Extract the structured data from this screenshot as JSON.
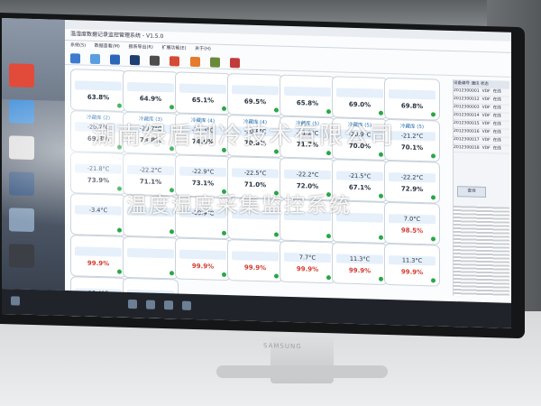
{
  "app": {
    "title": "温湿度数据记录监控管理系统 - V1.5.0",
    "menu": [
      "系统(S)",
      "数据查看(M)",
      "报表导出(R)",
      "扩展功能(E)",
      "关于(H)"
    ]
  },
  "cards": [
    {
      "name": "",
      "temp": "",
      "hum": "63.8%",
      "warn": false
    },
    {
      "name": "",
      "temp": "",
      "hum": "64.9%",
      "warn": false
    },
    {
      "name": "",
      "temp": "",
      "hum": "65.1%",
      "warn": false
    },
    {
      "name": "",
      "temp": "",
      "hum": "69.5%",
      "warn": false
    },
    {
      "name": "",
      "temp": "",
      "hum": "65.8%",
      "warn": false
    },
    {
      "name": "",
      "temp": "",
      "hum": "69.0%",
      "warn": false
    },
    {
      "name": "",
      "temp": "",
      "hum": "69.8%",
      "warn": false
    },
    {
      "name": "冷藏库 (2)",
      "temp": "-20.7°C",
      "hum": "69.8%",
      "warn": false
    },
    {
      "name": "冷藏库 (3)",
      "temp": "-20.7°C",
      "hum": "73.8%",
      "warn": false
    },
    {
      "name": "冷藏库 (4)",
      "temp": "-21.3°C",
      "hum": "74.6%",
      "warn": false
    },
    {
      "name": "冷藏库 (4)",
      "temp": "-20.8°C",
      "hum": "70.8%",
      "warn": false
    },
    {
      "name": "冷藏库 (5)",
      "temp": "-21.2°C",
      "hum": "71.7%",
      "warn": false
    },
    {
      "name": "冷藏库 (5)",
      "temp": "-20.9°C",
      "hum": "70.0%",
      "warn": false
    },
    {
      "name": "冷藏库 (5)",
      "temp": "-21.2°C",
      "hum": "70.1%",
      "warn": false
    },
    {
      "name": "",
      "temp": "-21.8°C",
      "hum": "73.9%",
      "warn": false
    },
    {
      "name": "",
      "temp": "-22.2°C",
      "hum": "71.1%",
      "warn": false
    },
    {
      "name": "",
      "temp": "-22.9°C",
      "hum": "73.1%",
      "warn": false
    },
    {
      "name": "",
      "temp": "-22.5°C",
      "hum": "71.0%",
      "warn": false
    },
    {
      "name": "",
      "temp": "-22.2°C",
      "hum": "72.0%",
      "warn": false
    },
    {
      "name": "",
      "temp": "-21.5°C",
      "hum": "67.1%",
      "warn": false
    },
    {
      "name": "",
      "temp": "-22.2°C",
      "hum": "72.9%",
      "warn": false
    },
    {
      "name": "",
      "temp": "-3.4°C",
      "hum": "",
      "warn": false
    },
    {
      "name": "",
      "temp": "",
      "hum": "",
      "warn": false
    },
    {
      "name": "",
      "temp": "-19.9°C",
      "hum": "",
      "warn": false
    },
    {
      "name": "",
      "temp": "",
      "hum": "",
      "warn": false
    },
    {
      "name": "",
      "temp": "",
      "hum": "",
      "warn": false
    },
    {
      "name": "",
      "temp": "",
      "hum": "",
      "warn": false
    },
    {
      "name": "",
      "temp": "7.0°C",
      "hum": "98.5%",
      "warn": true
    },
    {
      "name": "",
      "temp": "",
      "hum": "99.9%",
      "warn": true
    },
    {
      "name": "",
      "temp": "",
      "hum": "",
      "warn": false
    },
    {
      "name": "",
      "temp": "",
      "hum": "99.9%",
      "warn": true
    },
    {
      "name": "",
      "temp": "",
      "hum": "99.9%",
      "warn": true
    },
    {
      "name": "",
      "temp": "7.7°C",
      "hum": "99.9%",
      "warn": true
    },
    {
      "name": "",
      "temp": "11.3°C",
      "hum": "99.9%",
      "warn": true
    },
    {
      "name": "",
      "temp": "11.3°C",
      "hum": "99.9%",
      "warn": true
    },
    {
      "name": "",
      "temp": "10.4°C",
      "hum": "",
      "warn": false
    },
    {
      "name": "",
      "temp": "",
      "hum": "",
      "warn": false
    }
  ],
  "panel": {
    "headers": [
      "设备编号",
      "通讯",
      "状态"
    ],
    "rows": [
      [
        "2012300001",
        "VDF",
        "在线"
      ],
      [
        "2012300012",
        "VDF",
        "在线"
      ],
      [
        "2012300003",
        "VDF",
        "在线"
      ],
      [
        "2012300014",
        "VDF",
        "在线"
      ],
      [
        "2012300015",
        "VDF",
        "在线"
      ],
      [
        "2012300016",
        "VDF",
        "在线"
      ],
      [
        "2012300017",
        "VDF",
        "在线"
      ],
      [
        "2012300018",
        "VDF",
        "在线"
      ]
    ],
    "button": "查询"
  },
  "watermark": {
    "line1": "湖南绿盾制冷技术有限公司",
    "line2": "温度湿度采集监控系统"
  },
  "monitor_brand": "SAMSUNG"
}
